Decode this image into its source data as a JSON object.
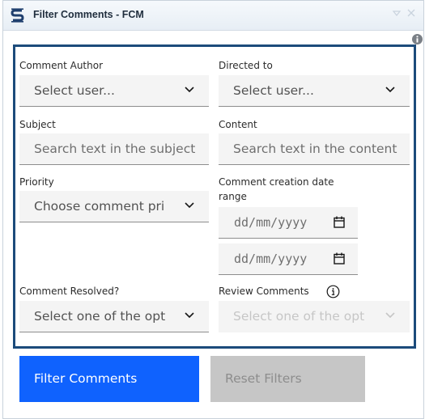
{
  "window": {
    "title": "Filter Comments - FCM",
    "icons": [
      "app-logo-icon",
      "minimize-icon",
      "close-icon",
      "info-icon"
    ]
  },
  "form": {
    "comment_author": {
      "label": "Comment Author",
      "value": "Select user..."
    },
    "directed_to": {
      "label": "Directed to",
      "value": "Select user..."
    },
    "subject": {
      "label": "Subject",
      "placeholder": "Search text in the subject"
    },
    "content": {
      "label": "Content",
      "placeholder": "Search text in the content"
    },
    "priority": {
      "label": "Priority",
      "value": "Choose comment pri"
    },
    "date_range": {
      "label_line1": "Comment creation date",
      "label_line2": "range",
      "start_placeholder": "dd/mm/yyyy",
      "end_placeholder": "dd/mm/yyyy"
    },
    "comment_resolved": {
      "label": "Comment Resolved?",
      "value": "Select one of the opt"
    },
    "review_comments": {
      "label": "Review Comments",
      "value": "Select one of the opt",
      "disabled": true
    }
  },
  "buttons": {
    "filter": "Filter Comments",
    "reset": "Reset Filters"
  },
  "colors": {
    "panel_border": "#1c4b7b",
    "primary": "#0f62fe",
    "disabled": "#c6c6c6"
  }
}
